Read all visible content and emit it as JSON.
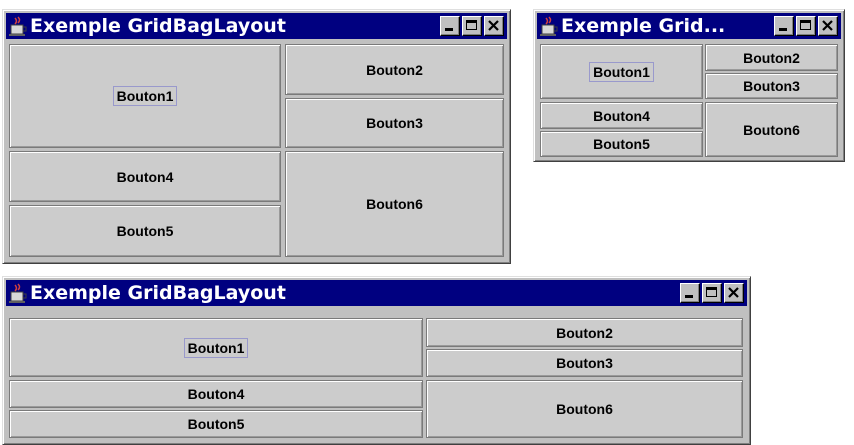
{
  "windows": [
    {
      "title": "Exemple GridBagLayout",
      "buttons": [
        "Bouton1",
        "Bouton2",
        "Bouton3",
        "Bouton4",
        "Bouton5",
        "Bouton6"
      ]
    },
    {
      "title": "Exemple Grid...",
      "buttons": [
        "Bouton1",
        "Bouton2",
        "Bouton3",
        "Bouton4",
        "Bouton5",
        "Bouton6"
      ]
    },
    {
      "title": "Exemple GridBagLayout",
      "buttons": [
        "Bouton1",
        "Bouton2",
        "Bouton3",
        "Bouton4",
        "Bouton5",
        "Bouton6"
      ]
    }
  ],
  "colors": {
    "titlebar": "#000080",
    "window_bg": "#c0c0c0",
    "button_bg": "#cccccc",
    "focus_outline": "#9999cc"
  },
  "icons": {
    "app": "java-cup-icon",
    "minimize": "minimize-icon",
    "maximize": "maximize-icon",
    "close": "close-icon"
  }
}
